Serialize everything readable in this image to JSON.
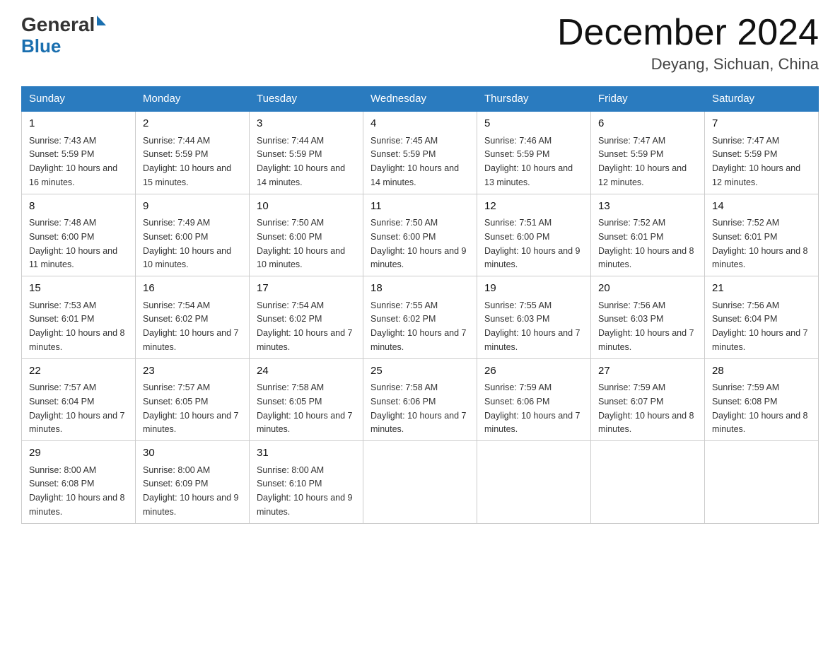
{
  "header": {
    "logo_general": "General",
    "logo_blue": "Blue",
    "month_title": "December 2024",
    "location": "Deyang, Sichuan, China"
  },
  "days_of_week": [
    "Sunday",
    "Monday",
    "Tuesday",
    "Wednesday",
    "Thursday",
    "Friday",
    "Saturday"
  ],
  "weeks": [
    [
      {
        "day": "1",
        "sunrise": "7:43 AM",
        "sunset": "5:59 PM",
        "daylight": "10 hours and 16 minutes."
      },
      {
        "day": "2",
        "sunrise": "7:44 AM",
        "sunset": "5:59 PM",
        "daylight": "10 hours and 15 minutes."
      },
      {
        "day": "3",
        "sunrise": "7:44 AM",
        "sunset": "5:59 PM",
        "daylight": "10 hours and 14 minutes."
      },
      {
        "day": "4",
        "sunrise": "7:45 AM",
        "sunset": "5:59 PM",
        "daylight": "10 hours and 14 minutes."
      },
      {
        "day": "5",
        "sunrise": "7:46 AM",
        "sunset": "5:59 PM",
        "daylight": "10 hours and 13 minutes."
      },
      {
        "day": "6",
        "sunrise": "7:47 AM",
        "sunset": "5:59 PM",
        "daylight": "10 hours and 12 minutes."
      },
      {
        "day": "7",
        "sunrise": "7:47 AM",
        "sunset": "5:59 PM",
        "daylight": "10 hours and 12 minutes."
      }
    ],
    [
      {
        "day": "8",
        "sunrise": "7:48 AM",
        "sunset": "6:00 PM",
        "daylight": "10 hours and 11 minutes."
      },
      {
        "day": "9",
        "sunrise": "7:49 AM",
        "sunset": "6:00 PM",
        "daylight": "10 hours and 10 minutes."
      },
      {
        "day": "10",
        "sunrise": "7:50 AM",
        "sunset": "6:00 PM",
        "daylight": "10 hours and 10 minutes."
      },
      {
        "day": "11",
        "sunrise": "7:50 AM",
        "sunset": "6:00 PM",
        "daylight": "10 hours and 9 minutes."
      },
      {
        "day": "12",
        "sunrise": "7:51 AM",
        "sunset": "6:00 PM",
        "daylight": "10 hours and 9 minutes."
      },
      {
        "day": "13",
        "sunrise": "7:52 AM",
        "sunset": "6:01 PM",
        "daylight": "10 hours and 8 minutes."
      },
      {
        "day": "14",
        "sunrise": "7:52 AM",
        "sunset": "6:01 PM",
        "daylight": "10 hours and 8 minutes."
      }
    ],
    [
      {
        "day": "15",
        "sunrise": "7:53 AM",
        "sunset": "6:01 PM",
        "daylight": "10 hours and 8 minutes."
      },
      {
        "day": "16",
        "sunrise": "7:54 AM",
        "sunset": "6:02 PM",
        "daylight": "10 hours and 7 minutes."
      },
      {
        "day": "17",
        "sunrise": "7:54 AM",
        "sunset": "6:02 PM",
        "daylight": "10 hours and 7 minutes."
      },
      {
        "day": "18",
        "sunrise": "7:55 AM",
        "sunset": "6:02 PM",
        "daylight": "10 hours and 7 minutes."
      },
      {
        "day": "19",
        "sunrise": "7:55 AM",
        "sunset": "6:03 PM",
        "daylight": "10 hours and 7 minutes."
      },
      {
        "day": "20",
        "sunrise": "7:56 AM",
        "sunset": "6:03 PM",
        "daylight": "10 hours and 7 minutes."
      },
      {
        "day": "21",
        "sunrise": "7:56 AM",
        "sunset": "6:04 PM",
        "daylight": "10 hours and 7 minutes."
      }
    ],
    [
      {
        "day": "22",
        "sunrise": "7:57 AM",
        "sunset": "6:04 PM",
        "daylight": "10 hours and 7 minutes."
      },
      {
        "day": "23",
        "sunrise": "7:57 AM",
        "sunset": "6:05 PM",
        "daylight": "10 hours and 7 minutes."
      },
      {
        "day": "24",
        "sunrise": "7:58 AM",
        "sunset": "6:05 PM",
        "daylight": "10 hours and 7 minutes."
      },
      {
        "day": "25",
        "sunrise": "7:58 AM",
        "sunset": "6:06 PM",
        "daylight": "10 hours and 7 minutes."
      },
      {
        "day": "26",
        "sunrise": "7:59 AM",
        "sunset": "6:06 PM",
        "daylight": "10 hours and 7 minutes."
      },
      {
        "day": "27",
        "sunrise": "7:59 AM",
        "sunset": "6:07 PM",
        "daylight": "10 hours and 8 minutes."
      },
      {
        "day": "28",
        "sunrise": "7:59 AM",
        "sunset": "6:08 PM",
        "daylight": "10 hours and 8 minutes."
      }
    ],
    [
      {
        "day": "29",
        "sunrise": "8:00 AM",
        "sunset": "6:08 PM",
        "daylight": "10 hours and 8 minutes."
      },
      {
        "day": "30",
        "sunrise": "8:00 AM",
        "sunset": "6:09 PM",
        "daylight": "10 hours and 9 minutes."
      },
      {
        "day": "31",
        "sunrise": "8:00 AM",
        "sunset": "6:10 PM",
        "daylight": "10 hours and 9 minutes."
      },
      null,
      null,
      null,
      null
    ]
  ],
  "labels": {
    "sunrise": "Sunrise:",
    "sunset": "Sunset:",
    "daylight": "Daylight:"
  }
}
